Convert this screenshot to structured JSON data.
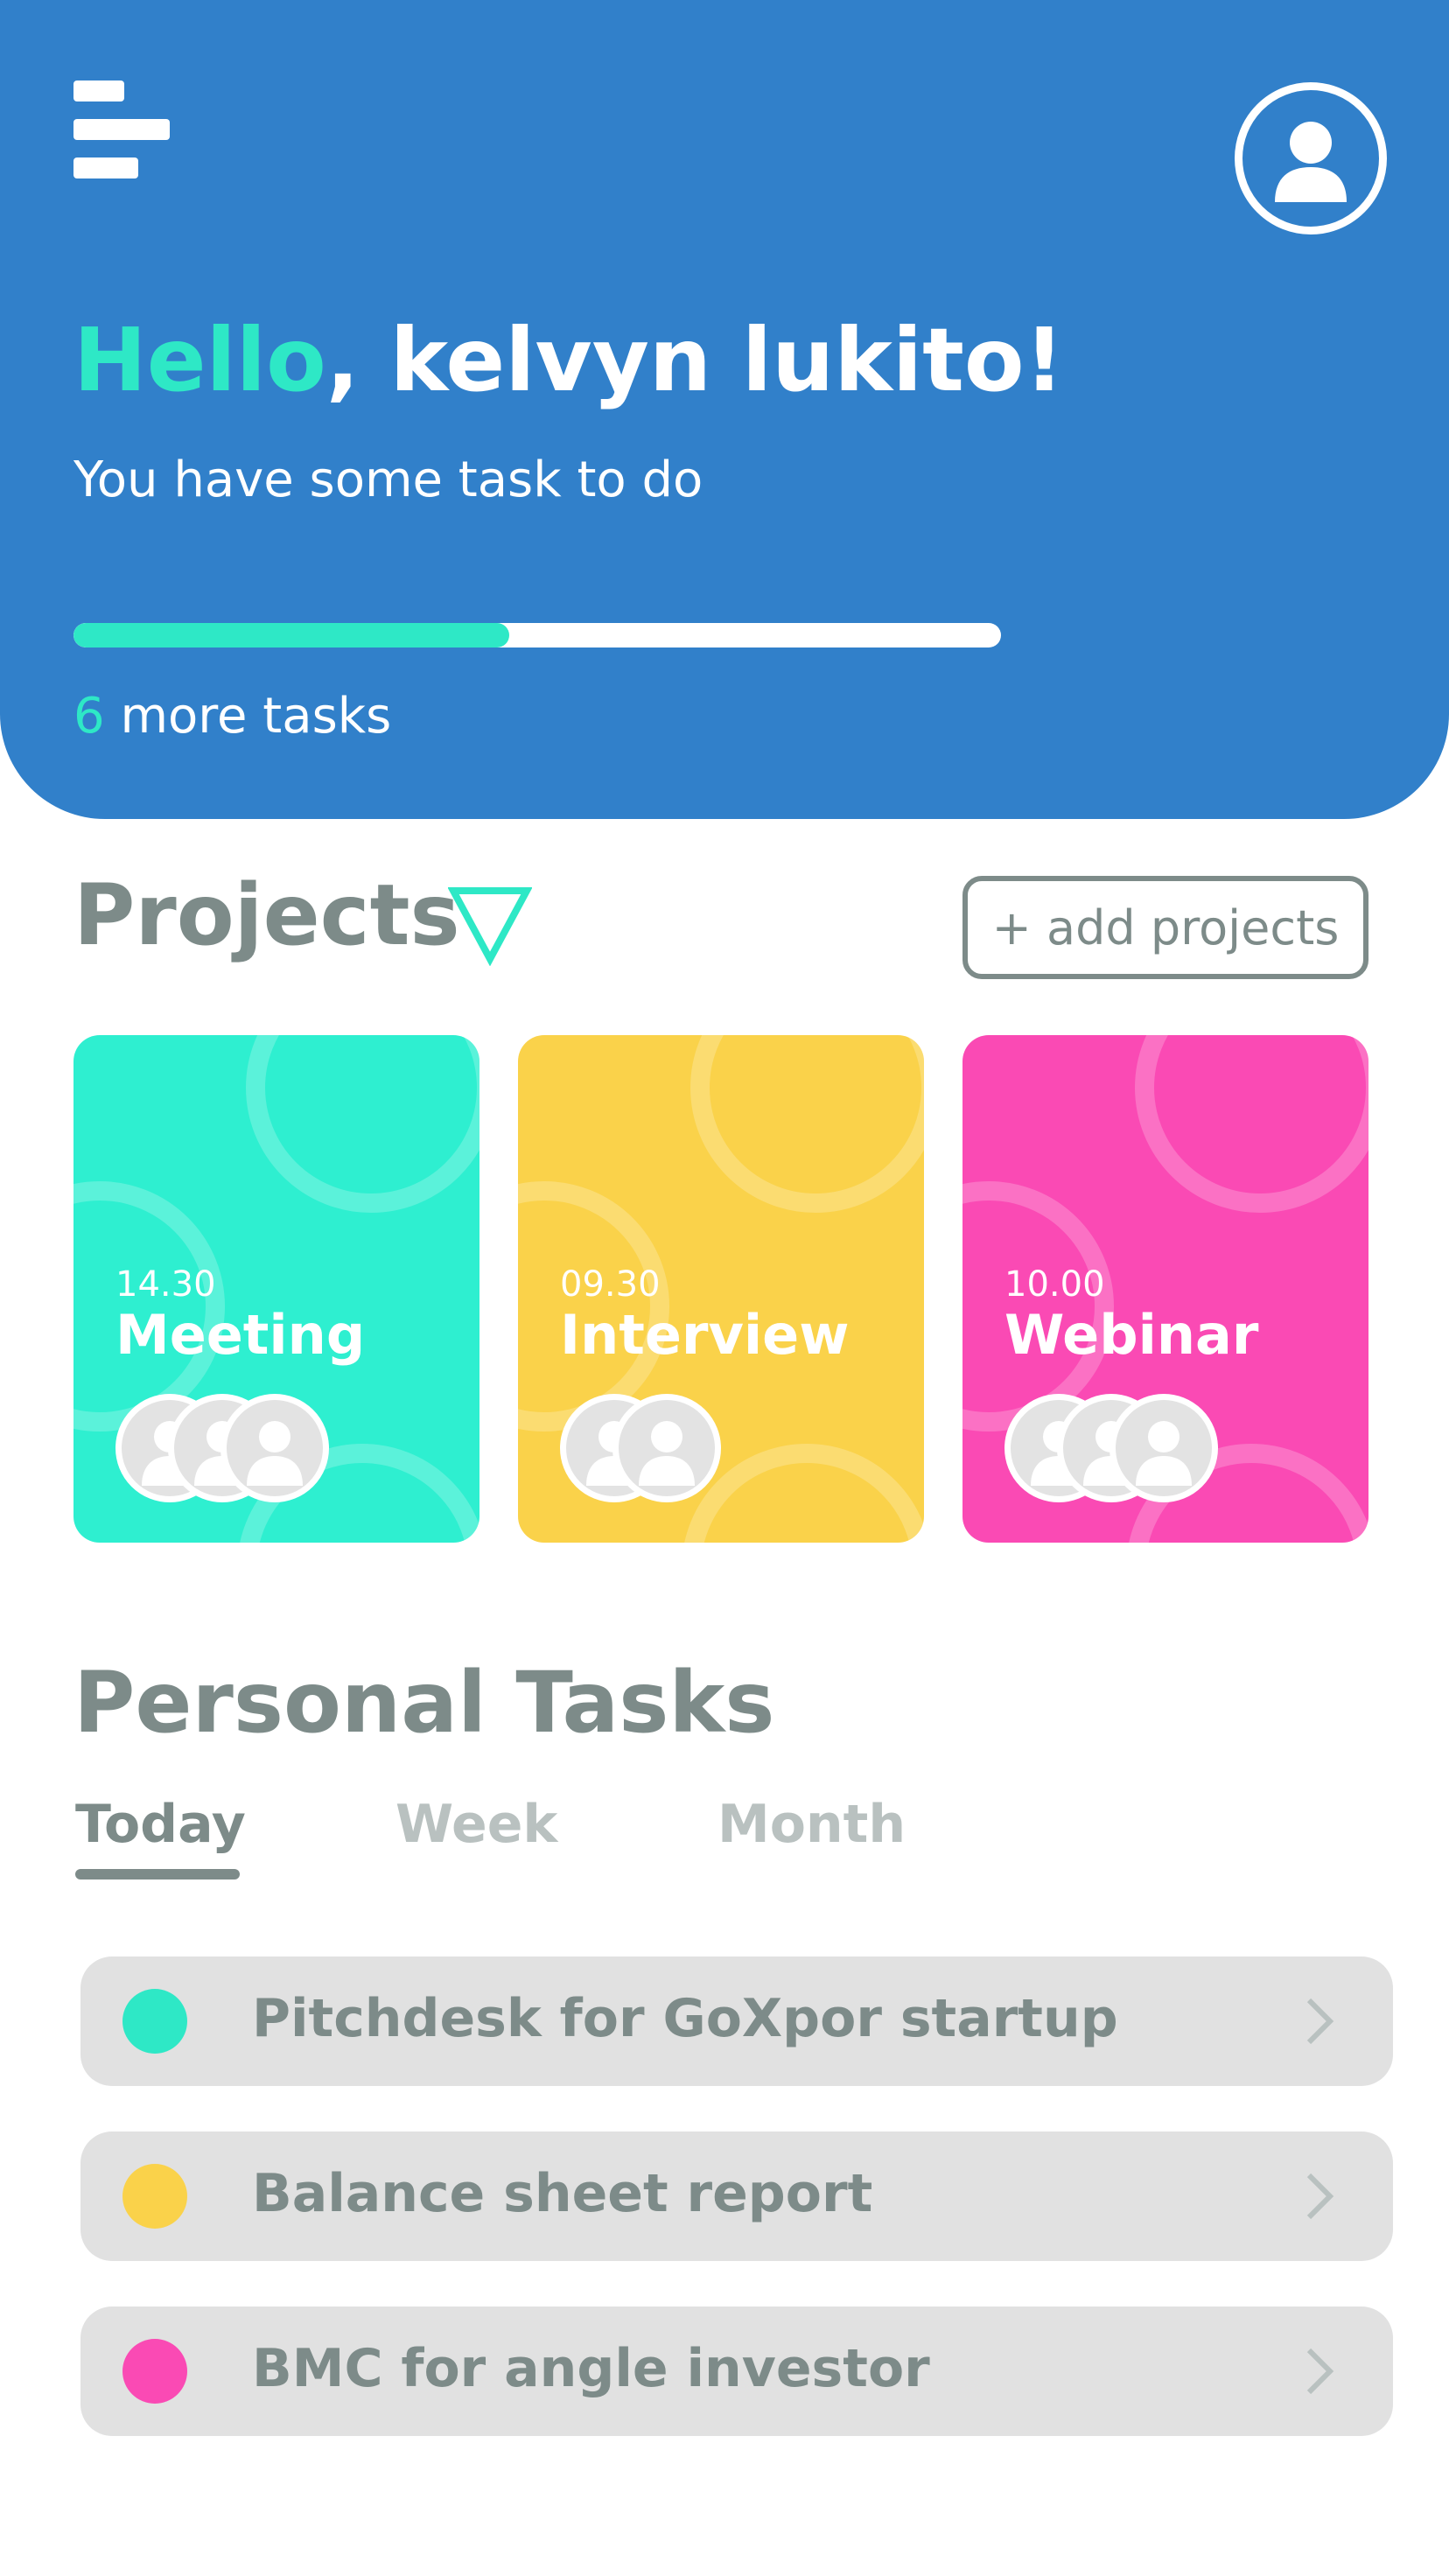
{
  "colors": {
    "header_bg": "#3180CA",
    "accent": "#2EE8C6",
    "text_muted": "#7d8b89",
    "tab_inactive": "#b9c1c0",
    "task_bg": "#e1e1e1"
  },
  "header": {
    "menu_icon": "hamburger-menu-icon",
    "profile_icon": "user-profile-icon",
    "greeting_hello": "Hello",
    "greeting_rest": ", kelvyn lukito!",
    "subtitle": "You have some task to do",
    "progress_fraction": 0.47,
    "more_count": "6",
    "more_text": " more tasks"
  },
  "projects": {
    "title": "Projects",
    "filter_icon": "triangle-down-icon",
    "add_label": "+ add projects",
    "cards": [
      {
        "time": "14.30",
        "name": "Meeting",
        "color": "#2EEFD0",
        "avatars": 3
      },
      {
        "time": "09.30",
        "name": "Interview",
        "color": "#FAD24A",
        "avatars": 2
      },
      {
        "time": "10.00",
        "name": "Webinar",
        "color": "#FA4AB4",
        "avatars": 3
      }
    ]
  },
  "personal_tasks": {
    "title": "Personal Tasks",
    "tabs": [
      {
        "label": "Today",
        "active": true
      },
      {
        "label": "Week",
        "active": false
      },
      {
        "label": "Month",
        "active": false
      }
    ],
    "items": [
      {
        "label": "Pitchdesk for GoXpor startup",
        "color": "#2EE8C6",
        "icon": "chevron-right-icon"
      },
      {
        "label": "Balance sheet report",
        "color": "#FAD24A",
        "icon": "chevron-right-icon"
      },
      {
        "label": "BMC for angle investor",
        "color": "#FA4AB4",
        "icon": "chevron-right-icon"
      }
    ]
  }
}
